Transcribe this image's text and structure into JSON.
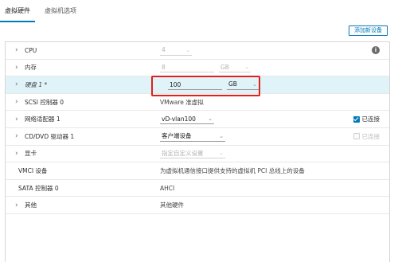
{
  "tabs": [
    {
      "label": "虚拟硬件",
      "active": true
    },
    {
      "label": "虚拟机选项",
      "active": false
    }
  ],
  "toolbar": {
    "add_device_label": "添加新设备"
  },
  "rows": {
    "cpu": {
      "label": "CPU",
      "value": "4"
    },
    "memory": {
      "label": "内存",
      "value": "8",
      "unit": "GB"
    },
    "disk": {
      "label": "硬盘 1 *",
      "value": "100",
      "unit": "GB"
    },
    "scsi": {
      "label": "SCSI 控制器 0",
      "value": "VMware 准虚拟"
    },
    "network": {
      "label": "网络适配器 1",
      "value": "vD-vlan100",
      "connect_label": "已连接",
      "connected": true
    },
    "cdrom": {
      "label": "CD/DVD 驱动器 1",
      "value": "客户端设备",
      "connect_label": "已连接",
      "connected": false
    },
    "video": {
      "label": "显卡",
      "value": "指定自定义设置"
    },
    "vmci": {
      "label": "VMCI 设备",
      "value": "为虚拟机通信接口提供支持的虚拟机 PCI 总线上的设备"
    },
    "sata": {
      "label": "SATA 控制器 0",
      "value": "AHCI"
    },
    "other": {
      "label": "其他",
      "value": "其他硬件"
    }
  },
  "colors": {
    "accent": "#0079b8",
    "highlight": "#e0201b",
    "selected_row": "#e0f3f8"
  }
}
